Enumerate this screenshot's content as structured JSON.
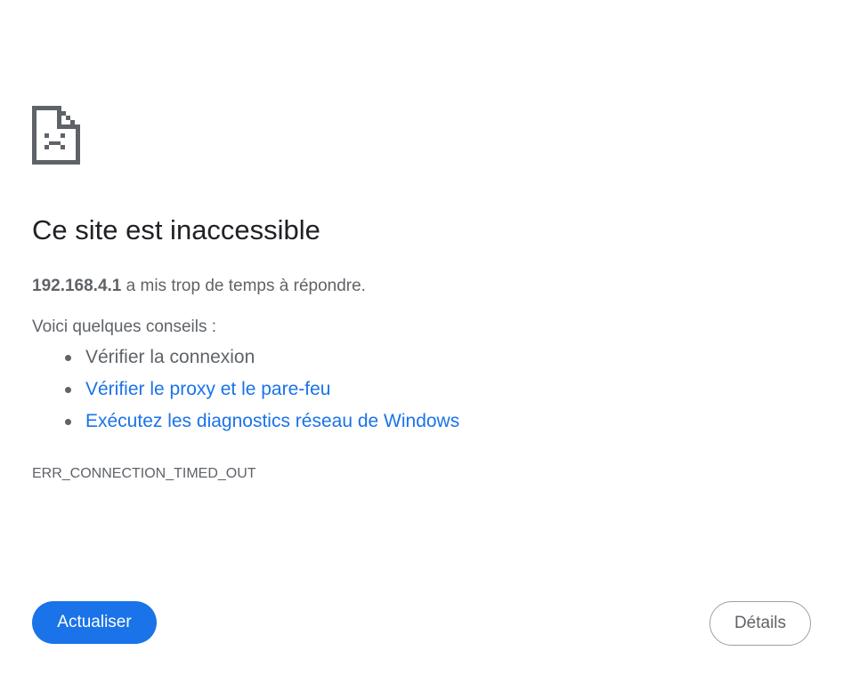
{
  "icon": "sad-document-icon",
  "title": "Ce site est inaccessible",
  "summary": {
    "host": "192.168.4.1",
    "message": " a mis trop de temps à répondre."
  },
  "tips": {
    "intro": "Voici quelques conseils :",
    "items": [
      {
        "label": "Vérifier la connexion",
        "is_link": false
      },
      {
        "label": "Vérifier le proxy et le pare-feu",
        "is_link": true
      },
      {
        "label": "Exécutez les diagnostics réseau de Windows",
        "is_link": true
      }
    ]
  },
  "error_code": "ERR_CONNECTION_TIMED_OUT",
  "buttons": {
    "reload_label": "Actualiser",
    "details_label": "Détails"
  },
  "colors": {
    "accent": "#1a73e8",
    "text_primary": "#202124",
    "text_secondary": "#5f6368"
  }
}
